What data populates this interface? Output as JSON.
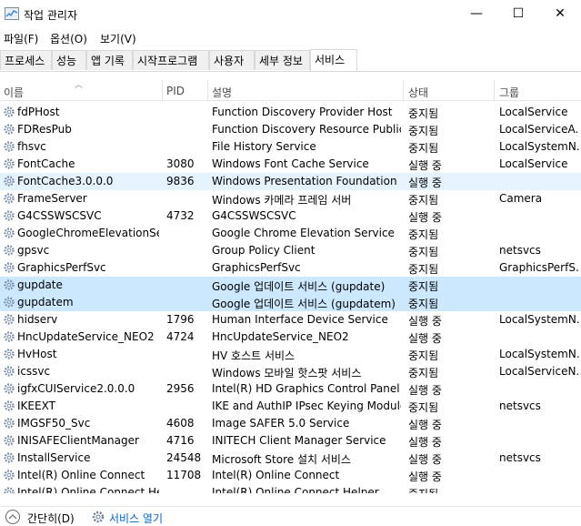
{
  "window": {
    "title": "작업 관리자",
    "minimize": "—",
    "maximize": "☐",
    "close": "✕"
  },
  "menu": [
    "파일(F)",
    "옵션(O)",
    "보기(V)"
  ],
  "tabs": [
    "프로세스",
    "성능",
    "앱 기록",
    "시작프로그램",
    "사용자",
    "세부 정보",
    "서비스"
  ],
  "active_tab": "서비스",
  "columns": [
    "이름",
    "PID",
    "설명",
    "상태",
    "그룹"
  ],
  "services": [
    {
      "name": "fdPHost",
      "pid": "",
      "desc": "Function Discovery Provider Host",
      "status": "중지됨",
      "group": "LocalService"
    },
    {
      "name": "FDResPub",
      "pid": "",
      "desc": "Function Discovery Resource Public...",
      "status": "중지됨",
      "group": "LocalServiceA..."
    },
    {
      "name": "fhsvc",
      "pid": "",
      "desc": "File History Service",
      "status": "중지됨",
      "group": "LocalSystemN..."
    },
    {
      "name": "FontCache",
      "pid": "3080",
      "desc": "Windows Font Cache Service",
      "status": "실행 중",
      "group": "LocalService"
    },
    {
      "name": "FontCache3.0.0.0",
      "pid": "9836",
      "desc": "Windows Presentation Foundation ...",
      "status": "실행 중",
      "group": ""
    },
    {
      "name": "FrameServer",
      "pid": "",
      "desc": "Windows 카메라 프레임 서버",
      "status": "중지됨",
      "group": "Camera"
    },
    {
      "name": "G4CSSWSCSVC",
      "pid": "4732",
      "desc": "G4CSSWSCSVC",
      "status": "실행 중",
      "group": ""
    },
    {
      "name": "GoogleChromeElevationSe...",
      "pid": "",
      "desc": "Google Chrome Elevation Service",
      "status": "중지됨",
      "group": ""
    },
    {
      "name": "gpsvc",
      "pid": "",
      "desc": "Group Policy Client",
      "status": "중지됨",
      "group": "netsvcs"
    },
    {
      "name": "GraphicsPerfSvc",
      "pid": "",
      "desc": "GraphicsPerfSvc",
      "status": "중지됨",
      "group": "GraphicsPerfS..."
    },
    {
      "name": "gupdate",
      "pid": "",
      "desc": "Google 업데이트 서비스 (gupdate)",
      "status": "중지됨",
      "group": ""
    },
    {
      "name": "gupdatem",
      "pid": "",
      "desc": "Google 업데이트 서비스 (gupdatem)",
      "status": "중지됨",
      "group": ""
    },
    {
      "name": "hidserv",
      "pid": "1796",
      "desc": "Human Interface Device Service",
      "status": "실행 중",
      "group": "LocalSystemN..."
    },
    {
      "name": "HncUpdateService_NEO2",
      "pid": "4724",
      "desc": "HncUpdateService_NEO2",
      "status": "실행 중",
      "group": ""
    },
    {
      "name": "HvHost",
      "pid": "",
      "desc": "HV 호스트 서비스",
      "status": "중지됨",
      "group": "LocalSystemN..."
    },
    {
      "name": "icssvc",
      "pid": "",
      "desc": "Windows 모바일 핫스팟 서비스",
      "status": "중지됨",
      "group": "LocalServiceN..."
    },
    {
      "name": "igfxCUIService2.0.0.0",
      "pid": "2956",
      "desc": "Intel(R) HD Graphics Control Panel ...",
      "status": "실행 중",
      "group": ""
    },
    {
      "name": "IKEEXT",
      "pid": "",
      "desc": "IKE and AuthIP IPsec Keying Modules",
      "status": "중지됨",
      "group": "netsvcs"
    },
    {
      "name": "IMGSF50_Svc",
      "pid": "4608",
      "desc": "Image SAFER 5.0 Service",
      "status": "실행 중",
      "group": ""
    },
    {
      "name": "INISAFEClientManager",
      "pid": "4716",
      "desc": "INITECH Client Manager Service",
      "status": "실행 중",
      "group": ""
    },
    {
      "name": "InstallService",
      "pid": "24548",
      "desc": "Microsoft Store 설치 서비스",
      "status": "실행 중",
      "group": "netsvcs"
    },
    {
      "name": "Intel(R) Online Connect",
      "pid": "11708",
      "desc": "Intel(R) Online Connect",
      "status": "실행 중",
      "group": ""
    },
    {
      "name": "Intel(R) Online Connect He...",
      "pid": "",
      "desc": "Intel(R) Online Connect Helper",
      "status": "중지됨",
      "group": ""
    }
  ],
  "selected_rows": [
    10,
    11
  ],
  "highlighted_rows": [
    4
  ],
  "footer": {
    "collapse_label": "간단히(D)",
    "open_services_label": "서비스 열기"
  },
  "colors": {
    "selected_bg": "#cce8ff",
    "hover_bg": "#e5f3ff",
    "link": "#0066cc"
  }
}
